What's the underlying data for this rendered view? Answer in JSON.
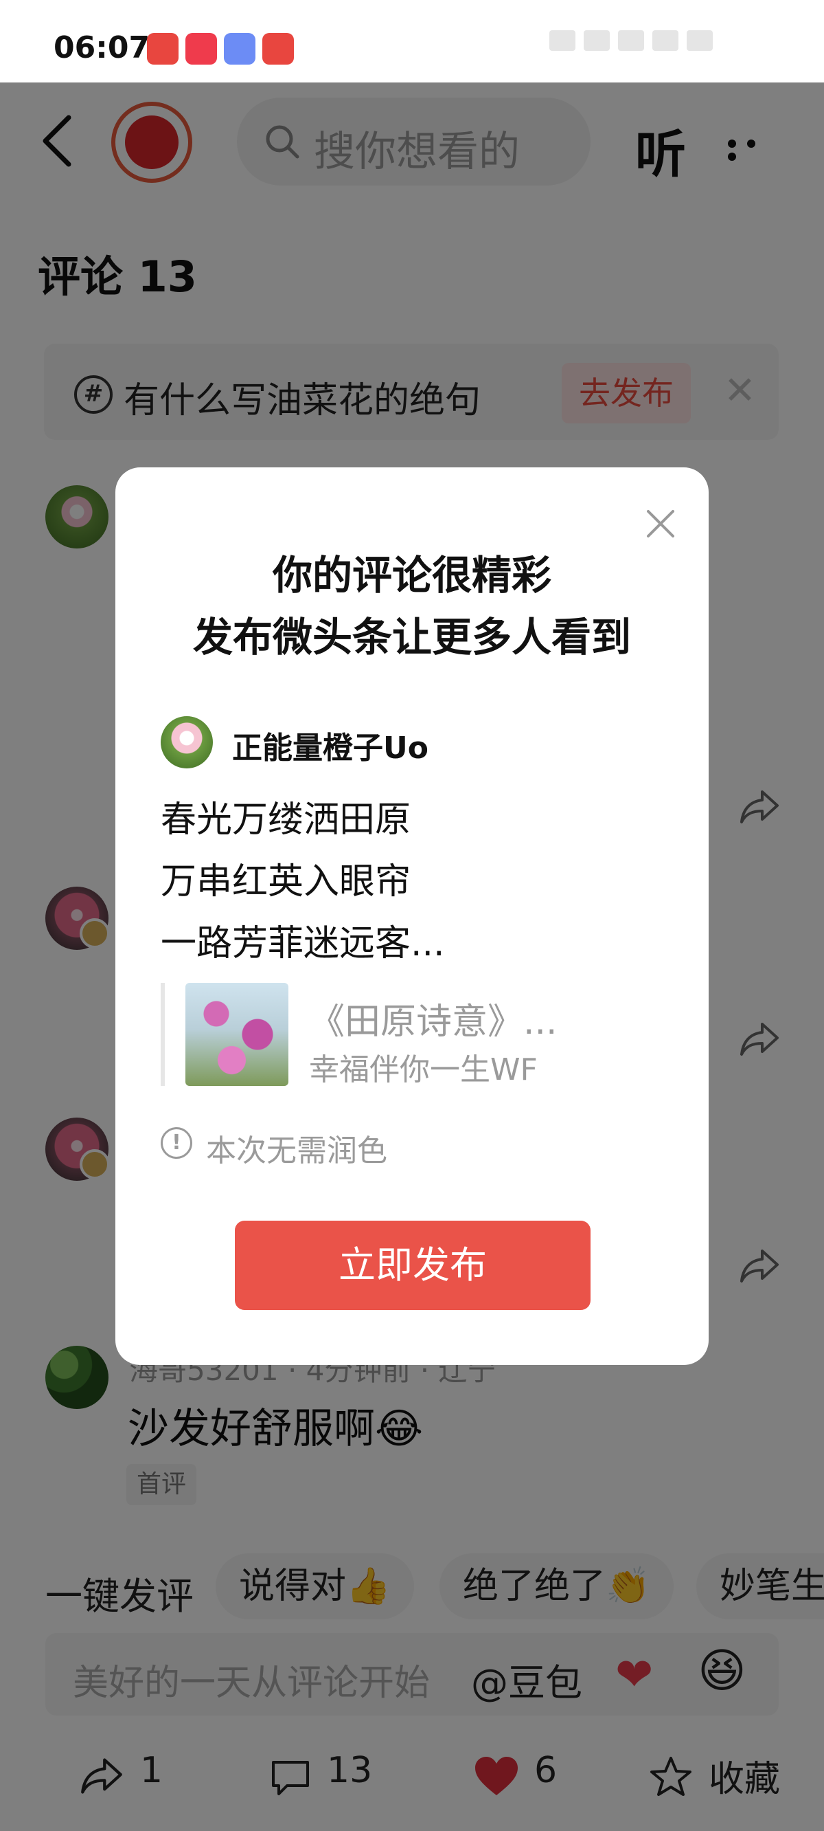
{
  "status_bar": {
    "time": "06:07"
  },
  "header": {
    "search_placeholder": "搜你想看的",
    "listen_label": "听"
  },
  "comments": {
    "title": "评论 13",
    "topic": {
      "text": "有什么写油菜花的绝句",
      "action": "去发布"
    },
    "visible_comment": {
      "meta": "海哥53201 · 4分钟前 · 辽宁",
      "text": "沙发好舒服啊😂",
      "tag": "首评"
    }
  },
  "quick_reply": {
    "label": "一键发评",
    "chips": [
      "说得对👍",
      "绝了绝了👏",
      "妙笔生"
    ]
  },
  "input": {
    "placeholder": "美好的一天从评论开始",
    "mention": "@豆包",
    "heart": "❤",
    "laugh": "😆"
  },
  "bottom_bar": {
    "share_count": "1",
    "comment_count": "13",
    "like_count": "6",
    "favorite_label": "收藏"
  },
  "modal": {
    "title_line1": "你的评论很精彩",
    "title_line2": "发布微头条让更多人看到",
    "author": "正能量橙子Uo",
    "lines": [
      "春光万缕洒田原",
      "万串红英入眼帘",
      "一路芳菲迷远客..."
    ],
    "quote_title": "《田原诗意》...",
    "quote_author": "幸福伴你一生WF",
    "note": "本次无需润色",
    "publish_label": "立即发布"
  },
  "colors": {
    "accent": "#ea5349",
    "overlay": "rgba(0,0,0,0.5)"
  }
}
